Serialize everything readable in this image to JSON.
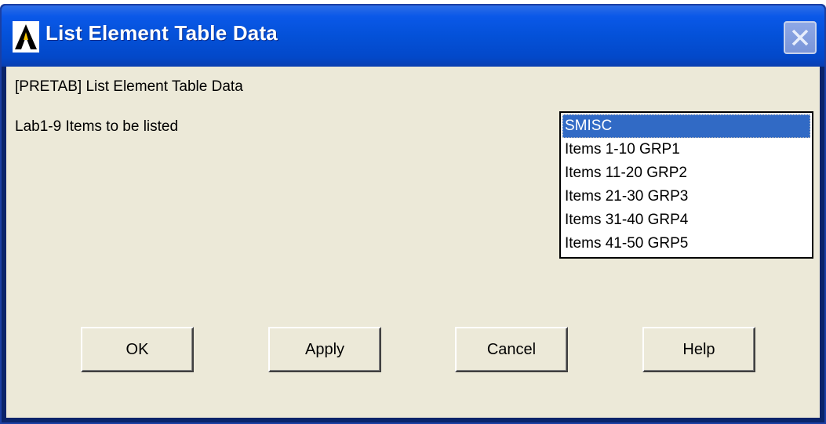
{
  "window": {
    "title": "List Element Table Data",
    "colors": {
      "titlebar": "#0451d8",
      "body": "#ece9d8",
      "selection": "#316ac5"
    },
    "icons": {
      "app": "ansys-logo-icon",
      "close": "close-icon"
    }
  },
  "dialog": {
    "command_label": "[PRETAB] List Element Table Data",
    "items_label": "Lab1-9  Items to be listed",
    "list": {
      "selected_index": 0,
      "items": [
        "SMISC",
        "Items  1-10 GRP1",
        "Items 11-20 GRP2",
        "Items 21-30 GRP3",
        "Items 31-40 GRP4",
        "Items 41-50 GRP5"
      ]
    }
  },
  "buttons": {
    "ok": "OK",
    "apply": "Apply",
    "cancel": "Cancel",
    "help": "Help"
  }
}
